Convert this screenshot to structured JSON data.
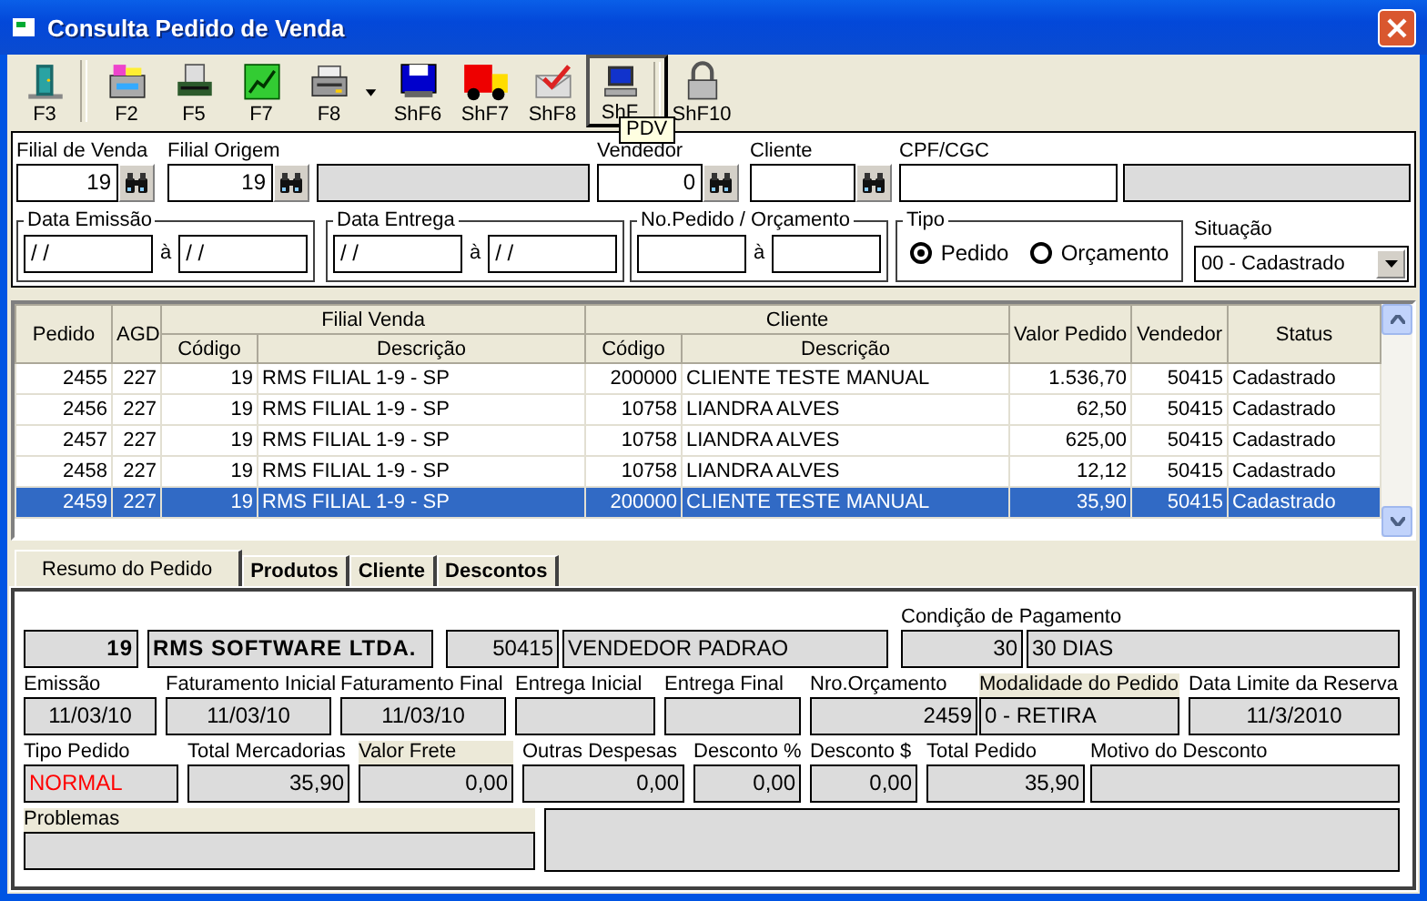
{
  "window": {
    "title": "Consulta Pedido de Venda"
  },
  "toolbar": [
    {
      "label": "F3",
      "hovered": false,
      "menu": false,
      "separator_after": true
    },
    {
      "label": "F2",
      "hovered": false,
      "menu": false,
      "separator_after": false
    },
    {
      "label": "F5",
      "hovered": false,
      "menu": false,
      "separator_after": false
    },
    {
      "label": "F7",
      "hovered": false,
      "menu": false,
      "separator_after": false
    },
    {
      "label": "F8",
      "hovered": false,
      "menu": true,
      "separator_after": false
    },
    {
      "label": "ShF6",
      "hovered": false,
      "menu": false,
      "separator_after": false
    },
    {
      "label": "ShF7",
      "hovered": false,
      "menu": false,
      "separator_after": false
    },
    {
      "label": "ShF8",
      "hovered": false,
      "menu": false,
      "separator_after": false
    },
    {
      "label": "ShF",
      "hovered": true,
      "menu": false,
      "separator_after": true
    },
    {
      "label": "ShF10",
      "hovered": false,
      "menu": false,
      "separator_after": false
    }
  ],
  "tooltip": "PDV",
  "filters": {
    "fields": [
      {
        "kind": "input",
        "label": "Filial de Venda",
        "value": "19",
        "lookup": true
      },
      {
        "kind": "input",
        "label": "Filial Origem",
        "value": "19",
        "lookup": true
      },
      {
        "kind": "display",
        "lookup": false
      },
      {
        "kind": "input",
        "label": "Vendedor",
        "value": "0",
        "lookup": true
      },
      {
        "kind": "input",
        "label": "Cliente",
        "lookup": true
      },
      {
        "kind": "input",
        "label": "CPF/CGC",
        "lookup": false
      },
      {
        "kind": "display",
        "lookup": false
      }
    ],
    "ranges": [
      {
        "legend": "Data Emissão",
        "from": "/ /",
        "separator": "à",
        "to": "/ /"
      },
      {
        "legend": "Data Entrega",
        "from": "/ /",
        "separator": "à",
        "to": "/ /"
      },
      {
        "legend": "No.Pedido / Orçamento",
        "separator": "à"
      }
    ],
    "tipo": {
      "legend": "Tipo",
      "options": [
        {
          "label": "Pedido",
          "selected": true
        },
        {
          "label": "Orçamento",
          "selected": false
        }
      ]
    },
    "situacao": {
      "label": "Situação",
      "value": "00 - Cadastrado"
    }
  },
  "table": {
    "header_groups": [
      {
        "label": "Pedido"
      },
      {
        "label": "AGD"
      },
      {
        "label": "Filial Venda",
        "sub": [
          "Código",
          "Descrição"
        ]
      },
      {
        "label": "Cliente",
        "sub": [
          "Código",
          "Descrição"
        ]
      },
      {
        "label": "Valor Pedido"
      },
      {
        "label": "Vendedor"
      },
      {
        "label": "Status"
      }
    ],
    "rows": [
      {
        "selected": false,
        "cells": [
          "2455",
          "227",
          "19",
          "RMS FILIAL 1-9 - SP",
          "200000",
          "CLIENTE TESTE MANUAL",
          "1.536,70",
          "50415",
          "Cadastrado"
        ]
      },
      {
        "selected": false,
        "cells": [
          "2456",
          "227",
          "19",
          "RMS FILIAL 1-9 - SP",
          "10758",
          "LIANDRA ALVES",
          "62,50",
          "50415",
          "Cadastrado"
        ]
      },
      {
        "selected": false,
        "cells": [
          "2457",
          "227",
          "19",
          "RMS FILIAL 1-9 - SP",
          "10758",
          "LIANDRA ALVES",
          "625,00",
          "50415",
          "Cadastrado"
        ]
      },
      {
        "selected": false,
        "cells": [
          "2458",
          "227",
          "19",
          "RMS FILIAL 1-9 - SP",
          "10758",
          "LIANDRA ALVES",
          "12,12",
          "50415",
          "Cadastrado"
        ]
      },
      {
        "selected": true,
        "cells": [
          "2459",
          "227",
          "19",
          "RMS FILIAL 1-9 - SP",
          "200000",
          "CLIENTE TESTE MANUAL",
          "35,90",
          "50415",
          "Cadastrado"
        ]
      }
    ]
  },
  "tabs": [
    {
      "label": "Resumo do Pedido",
      "selected": true
    },
    {
      "label": "Produtos",
      "selected": false
    },
    {
      "label": "Cliente",
      "selected": false
    },
    {
      "label": "Descontos",
      "selected": false
    }
  ],
  "summary": [
    {
      "cells": [
        {
          "value": "19"
        },
        {
          "value": "RMS SOFTWARE LTDA."
        },
        {
          "value": "50415"
        },
        {
          "value": "VENDEDOR PADRAO"
        },
        {
          "label": "Condição de Pagamento",
          "value": "30"
        },
        {
          "value": "30 DIAS"
        }
      ]
    },
    {
      "cells": [
        {
          "label": "Emissão",
          "value": "11/03/10"
        },
        {
          "label": "Faturamento Inicial",
          "value": "11/03/10"
        },
        {
          "label": "Faturamento Final",
          "value": "11/03/10"
        },
        {
          "label": "Entrega Inicial"
        },
        {
          "label": "Entrega Final"
        },
        {
          "label": "Nro.Orçamento",
          "value": "2459"
        },
        {
          "label": "Modalidade do Pedido",
          "highlighted": true,
          "value": "0 - RETIRA"
        },
        {
          "label": "Data Limite da Reserva",
          "value": "11/3/2010"
        }
      ]
    },
    {
      "cells": [
        {
          "label": "Tipo Pedido",
          "value": "NORMAL",
          "color": "#ff0000"
        },
        {
          "label": "Total Mercadorias",
          "value": "35,90"
        },
        {
          "label": "Valor Frete",
          "highlighted": true,
          "value": "0,00"
        },
        {
          "label": "Outras Despesas",
          "value": "0,00"
        },
        {
          "label": "Desconto %",
          "value": "0,00"
        },
        {
          "label": "Desconto $",
          "value": "0,00"
        },
        {
          "label": "Total Pedido",
          "value": "35,90"
        },
        {
          "label": "Motivo do Desconto"
        }
      ]
    },
    {
      "cells": [
        {
          "label": "Problemas",
          "highlighted": true
        }
      ]
    }
  ]
}
